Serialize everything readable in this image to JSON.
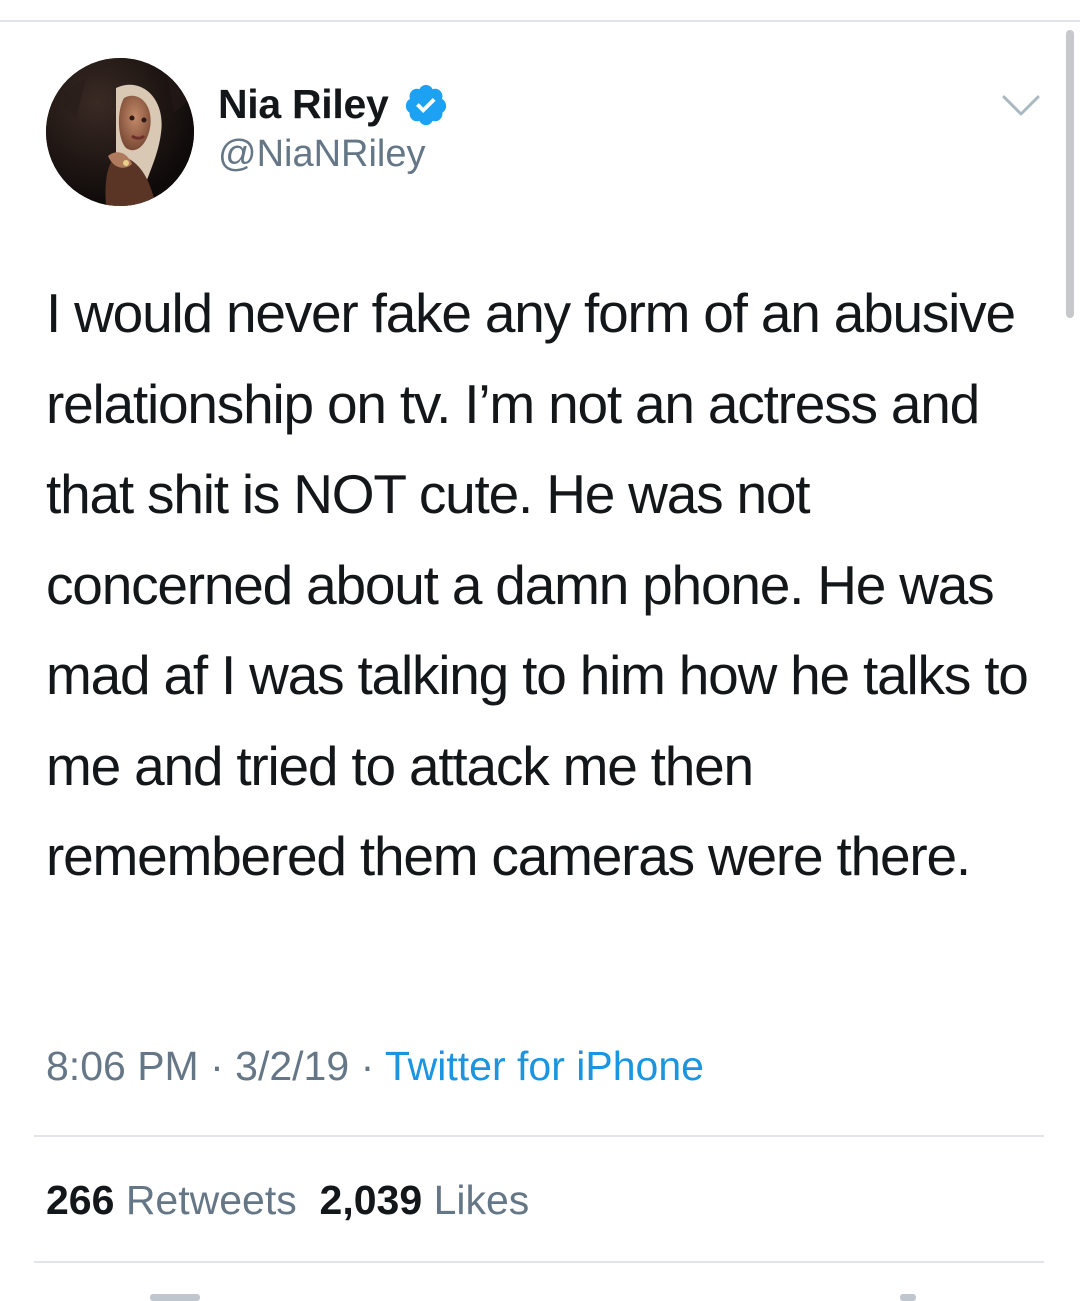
{
  "author": {
    "display_name": "Nia Riley",
    "handle": "@NiaNRiley",
    "verified": true,
    "verified_icon": "verified-badge-icon",
    "avatar": "profile-photo"
  },
  "tweet": {
    "text": "I would never fake any form of an abusive relationship on tv. I’m not an actress and that shit is NOT cute. He was not concerned about a damn phone. He was mad af I was talking to him how he talks to me and tried to attack me then remembered them cameras were there.",
    "time": "8:06 PM",
    "date": "3/2/19",
    "separator": "·",
    "source": "Twitter for iPhone"
  },
  "stats": {
    "retweets_count": "266",
    "retweets_label": "Retweets",
    "likes_count": "2,039",
    "likes_label": "Likes"
  },
  "menu": {
    "icon": "chevron-down-icon"
  },
  "colors": {
    "text": "#14171a",
    "secondary": "#657786",
    "link": "#1b95e0",
    "verified": "#1da1f2",
    "divider": "#e1e4e8"
  }
}
